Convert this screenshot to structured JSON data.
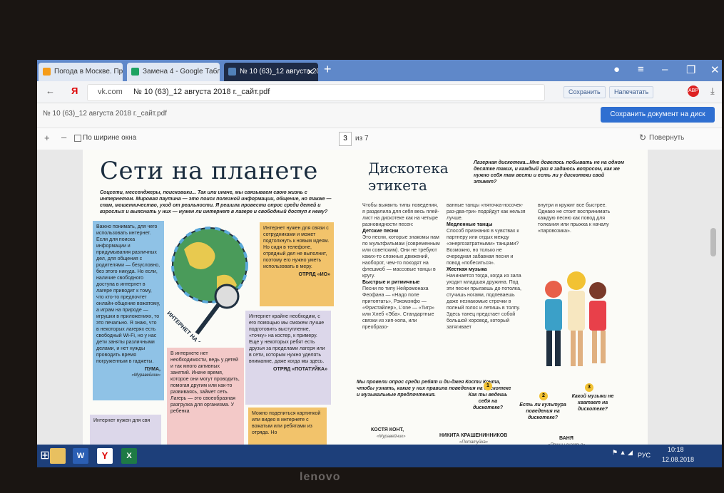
{
  "tabs": [
    {
      "label": "Погода в Москве. Прогноз",
      "fav": "#f59c1a"
    },
    {
      "label": "Замена 4 - Google Таблиц",
      "fav": "#1ea362"
    },
    {
      "label": "№ 10 (63)_12 августа 20",
      "fav": "#5181b8"
    }
  ],
  "address": {
    "host": "vk.com",
    "title": "№ 10 (63)_12 августа 2018 г._сайт.pdf",
    "save": "Сохранить",
    "print": "Напечатать"
  },
  "pdf": {
    "file": "№ 10 (63)_12 августа 2018 г._сайт.pdf",
    "save_disk": "Сохранить документ на диск",
    "fit": "По ширине окна",
    "page": "3",
    "of": "из 7",
    "rotate": "Повернуть"
  },
  "article1": {
    "title": "Сети на планете",
    "lead": "Соцсети, мессенджеры, поисковики... Так или иначе, мы связываем свою жизнь с интернетом. Мировая паутина — это поиск полезной информации, общение, но также — спам, мошенничество, уход от реальности. Я решила провести опрос среди детей и взрослых и выяснить у них — нужен ли интернет в лагере и свободный доступ к нему?",
    "blue": "Важно понимать, для чего использовать интернет. Если для поиска информации и придумывания различных дел, для общения с родителями — безусловно, без этого никуда. Но если, наличие свободного доступа в интернет в лагере приводит к тому, что кто-то предпочтет онлайн-общение вожатому, а играм на природе — игрушки в приложениях, то это печально. Я знаю, что в некоторых лагерях есть свободный Wi-Fi, но у нас дети заняты различными делами, и нет нужды проводить время погруженным в гаджеты.",
    "blue_sig": "ПУМА,",
    "blue_sub": "«Муравейник»",
    "orange": "Интернет нужен для связи с сотрудниками и может подтолкнуть к новым идеям. Но сидя в телефоне, отрядный дел не выполнит, поэтому его нужно уметь использовать в меру.",
    "orange_sig": "ОТРЯД «ИО»",
    "lav1": "Интернет крайне необходим, с его помощью мы сможем лучше подготовить выступление, «точку» на костер, к примеру. Еще у некоторых ребят есть друзья за пределами лагеря или в сети, которым нужно уделять внимание, даже когда мы здесь.",
    "lav1_sig": "ОТРЯД «ПОТАТУЙКА»",
    "pink": "В интернете нет необходимости, ведь у детей и так много активных занятий. Иначе время, которое они могут проводить, помогая другим или как-то развиваясь, займет сеть. Лагерь — это своеобразная разгрузка для организма. У ребенка",
    "orange2": "Можно поделиться картинкой или видео в интернете с вожатым или ребятами из отряда. Но",
    "lav2": "Интернет нужен для свя",
    "globe_text": "ИНТЕРНЕТ НА ОП"
  },
  "article2": {
    "title": "Дискотека этикета",
    "lead": "Лазерная дискотека...Мне довелось побывать не на одном десятке таких, и каждый раз я задаюсь вопросом, как же нужно себя там вести и есть ли у дискотеки свой этикет?",
    "col1_intro": "Чтобы выявить типы поведения, я разделила для себя весь плей-лист на дискотеке как на четыре разновидности песен:",
    "col1_h1": "Детские песни",
    "col1_p1": "Это песни, которые знакомы нам по мультфильмам (современным или советским). Они не требуют каких-то сложных движений, наоборот, чем-то походят на флешмоб — массовые танцы в кругу.",
    "col1_h2": "Быстрые и ритмичные",
    "col1_p2": "Песни по типу Нейромонаха Феофана — «Надо поле притоптать», Рэкомэнфо — «Фристайлер», L'one — «Тигр» или Хлеб «Эба». Стандартные связки из хип-хопа, или преобразо-",
    "col2_p0": "ванные танцы «пяточка-носочек-раз-два-три» подойдут как нельзя лучше.",
    "col2_h1": "Медленные танцы",
    "col2_p1": "Способ признания в чувствах к партнеру или отдых между «энергозатратными» танцами? Возможно, но только не очередная забавная песня и повод «побеситься».",
    "col2_h2": "Жесткая музыка",
    "col2_p2": "Начинается тогда, когда из зала уходит младшая дружина. Под эти песни прыгаешь до потолка, стучишь ногами, подпеваешь даже незнакомые строчки в полный голос и летишь в толпу. Здесь танец предстает собой большой хоровод, который затягивает",
    "col3_p": "внутри и кружит все быстрее. Однако не стоит воспринимать каждую песню как повод для толкания или прыжка к началу «паровозика».",
    "survey_intro": "Мы провели опрос среди ребят и ди-джея Кости Конта, чтобы узнать, какие у них правила поведения на дискотеке и музыкальные предпочтения.",
    "questions": [
      "Как ты ведешь себя на дискотеке?",
      "Есть ли культура поведения на дискотеке?",
      "Какой музыки не хватает на дискотеке?"
    ],
    "people": [
      {
        "name": "КОСТЯ КОНТ,",
        "sub": "«Муравейник»"
      },
      {
        "name": "НИКИТА КРАШЕНИННИКОВ",
        "sub": "«Потатуйка»"
      },
      {
        "name": "ВАНЯ",
        "sub": "«Птицы счастья»"
      }
    ]
  },
  "taskbar": {
    "lang": "РУС",
    "time": "10:18",
    "date": "12.08.2018"
  },
  "brand": "lenovo"
}
